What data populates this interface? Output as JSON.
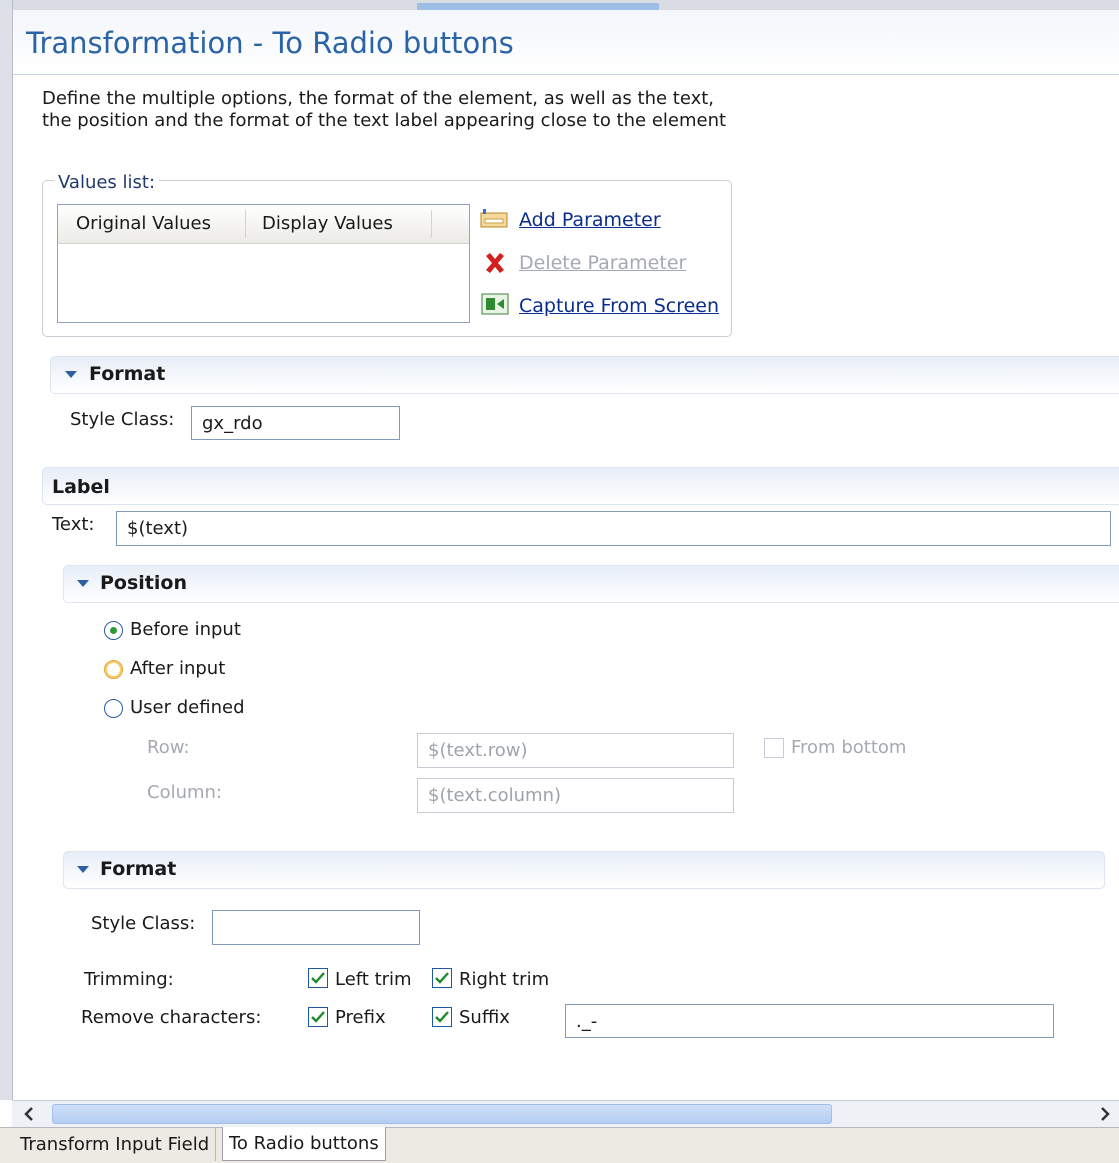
{
  "page": {
    "title": "Transformation - To Radio buttons",
    "description_line1": "Define the multiple options, the format of the element, as well as the text,",
    "description_line2": "the position and the format of the text label appearing close to the element"
  },
  "values_list": {
    "legend": "Values list:",
    "columns": [
      "Original Values",
      "Display Values"
    ],
    "actions": {
      "add": "Add Parameter",
      "delete": "Delete Parameter",
      "capture": "Capture From Screen"
    }
  },
  "format_section": {
    "title": "Format",
    "style_class_label": "Style Class:",
    "style_class_value": "gx_rdo"
  },
  "label_section": {
    "title": "Label",
    "text_label": "Text:",
    "text_value": "$(text)"
  },
  "position_section": {
    "title": "Position",
    "options": [
      "Before input",
      "After input",
      "User defined"
    ],
    "selected": "Before input",
    "row_label": "Row:",
    "row_value": "$(text.row)",
    "from_bottom_label": "From bottom",
    "column_label": "Column:",
    "column_value": "$(text.column)"
  },
  "label_format_section": {
    "title": "Format",
    "style_class_label": "Style Class:",
    "style_class_value": "",
    "trimming_label": "Trimming:",
    "left_trim_label": "Left trim",
    "right_trim_label": "Right trim",
    "remove_chars_label": "Remove characters:",
    "prefix_label": "Prefix",
    "suffix_label": "Suffix",
    "remove_chars_value": "._-"
  },
  "bottom_tabs": [
    "Transform Input Field",
    "To Radio buttons"
  ],
  "colors": {
    "title": "#2b64a6",
    "link": "#0b2d8e",
    "disabled": "#a5a9b1",
    "section_gradient_top": "#e7eef8"
  }
}
